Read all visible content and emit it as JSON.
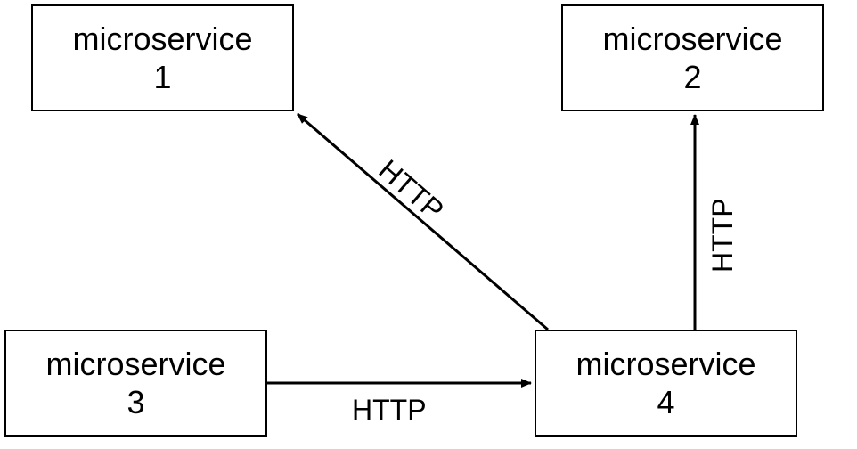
{
  "nodes": {
    "n1": {
      "label_top": "microservice",
      "label_bottom": "1"
    },
    "n2": {
      "label_top": "microservice",
      "label_bottom": "2"
    },
    "n3": {
      "label_top": "microservice",
      "label_bottom": "3"
    },
    "n4": {
      "label_top": "microservice",
      "label_bottom": "4"
    }
  },
  "edges": {
    "e_3_to_4": {
      "label": "HTTP"
    },
    "e_4_to_1": {
      "label": "HTTP"
    },
    "e_4_to_2": {
      "label": "HTTP"
    }
  }
}
